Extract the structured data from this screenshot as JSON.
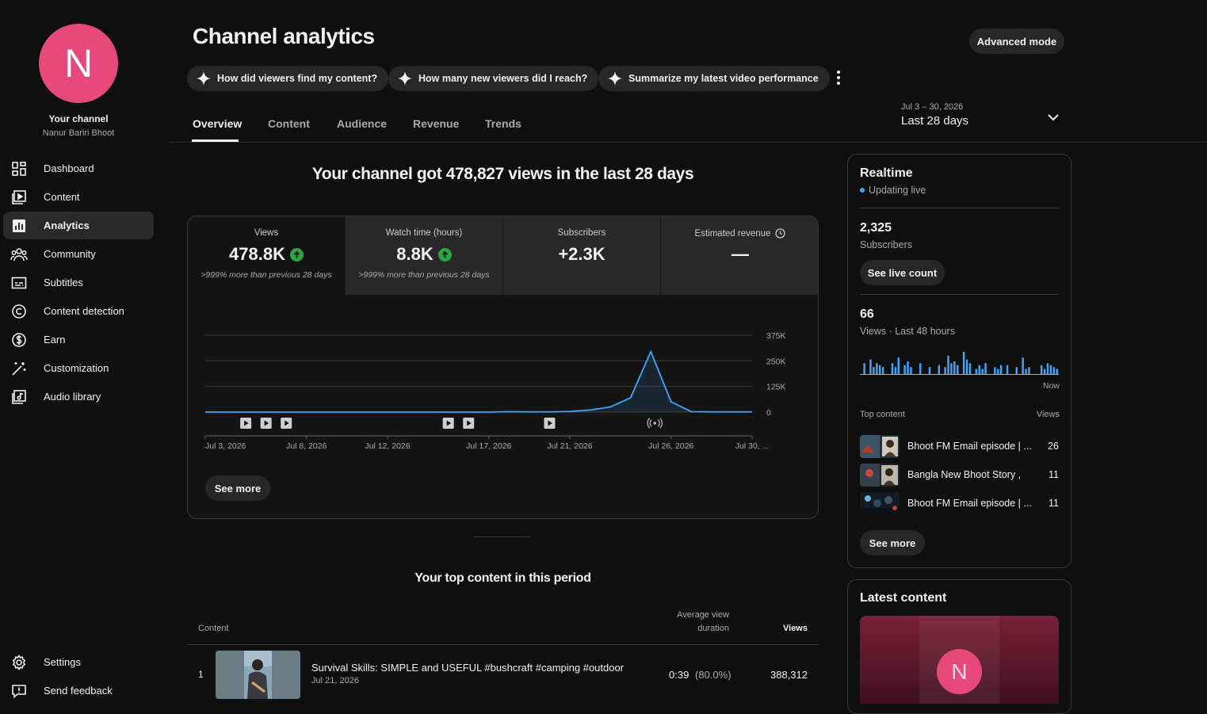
{
  "channel": {
    "avatar_letter": "N",
    "label": "Your channel",
    "name": "Nanur Bariri Bhoot"
  },
  "nav": [
    {
      "label": "Dashboard",
      "icon": "dashboard-icon"
    },
    {
      "label": "Content",
      "icon": "content-icon"
    },
    {
      "label": "Analytics",
      "icon": "analytics-icon"
    },
    {
      "label": "Community",
      "icon": "community-icon"
    },
    {
      "label": "Subtitles",
      "icon": "subtitles-icon"
    },
    {
      "label": "Content detection",
      "icon": "copyright-icon"
    },
    {
      "label": "Earn",
      "icon": "dollar-icon"
    },
    {
      "label": "Customization",
      "icon": "magic-wand-icon"
    },
    {
      "label": "Audio library",
      "icon": "audio-library-icon"
    }
  ],
  "nav_bottom": [
    {
      "label": "Settings",
      "icon": "gear-icon"
    },
    {
      "label": "Send feedback",
      "icon": "feedback-icon"
    }
  ],
  "header": {
    "title": "Channel analytics",
    "advanced_mode": "Advanced mode",
    "chips": [
      "How did viewers find my content?",
      "How many new viewers did I reach?",
      "Summarize my latest video performance"
    ],
    "tabs": [
      "Overview",
      "Content",
      "Audience",
      "Revenue",
      "Trends"
    ],
    "date_range_sub": "Jul 3 – 30, 2026",
    "date_range_main": "Last 28 days"
  },
  "overview": {
    "headline": "Your channel got 478,827 views in the last 28 days",
    "metrics": [
      {
        "label": "Views",
        "value": "478.8K",
        "sub": ">999% more than previous 28 days",
        "trend": "up"
      },
      {
        "label": "Watch time (hours)",
        "value": "8.8K",
        "sub": ">999% more than previous 28 days",
        "trend": "up"
      },
      {
        "label": "Subscribers",
        "value": "+2.3K",
        "sub": "",
        "trend": ""
      },
      {
        "label": "Estimated revenue",
        "value": "—",
        "sub": "",
        "trend": ""
      }
    ],
    "see_more": "See more"
  },
  "chart_data": {
    "type": "area",
    "x": [
      "Jul 3",
      "Jul 4",
      "Jul 5",
      "Jul 6",
      "Jul 7",
      "Jul 8",
      "Jul 9",
      "Jul 10",
      "Jul 11",
      "Jul 12",
      "Jul 13",
      "Jul 14",
      "Jul 15",
      "Jul 16",
      "Jul 17",
      "Jul 18",
      "Jul 19",
      "Jul 20",
      "Jul 21",
      "Jul 22",
      "Jul 23",
      "Jul 24",
      "Jul 25",
      "Jul 26",
      "Jul 27",
      "Jul 28",
      "Jul 29",
      "Jul 30"
    ],
    "values": [
      0,
      0,
      0,
      0,
      0,
      0,
      0,
      0,
      0,
      0,
      0,
      0,
      0,
      0,
      0,
      2000,
      1000,
      1000,
      3000,
      10000,
      25000,
      70000,
      295000,
      50000,
      2000,
      1000,
      1000,
      1000
    ],
    "x_tick_labels": [
      "Jul 3, 2026",
      "Jul 8, 2026",
      "Jul 12, 2026",
      "Jul 17, 2026",
      "Jul 21, 2026",
      "Jul 26, 2026",
      "Jul 30, ..."
    ],
    "x_tick_indices": [
      0,
      5,
      9,
      14,
      18,
      23,
      27
    ],
    "y_ticks": [
      0,
      125000,
      250000,
      375000
    ],
    "y_tick_labels": [
      "0",
      "125K",
      "250K",
      "375K"
    ],
    "ylim": [
      0,
      375000
    ],
    "video_markers": [
      2,
      3,
      4,
      12,
      13,
      17
    ],
    "live_markers": [
      22
    ],
    "grid": true,
    "color": "#3ea6ff"
  },
  "top_content": {
    "title": "Your top content in this period",
    "col_content": "Content",
    "col_avd_line1": "Average view",
    "col_avd_line2": "duration",
    "col_views": "Views",
    "rows": [
      {
        "rank": "1",
        "title": "Survival Skills: SIMPLE and USEFUL #bushcraft #camping #outdoor",
        "date": "Jul 21, 2026",
        "avd": "0:39",
        "avd_pct": "(80.0%)",
        "views": "388,312"
      }
    ]
  },
  "realtime": {
    "title": "Realtime",
    "status": "Updating live",
    "subs_value": "2,325",
    "subs_label": "Subscribers",
    "see_live_count": "See live count",
    "views_value": "66",
    "views_label": "Views · Last 48 hours",
    "now_label": "Now",
    "bars": [
      0,
      4,
      0,
      6,
      2,
      4,
      3,
      2,
      0,
      0,
      4,
      2,
      7,
      0,
      3,
      5,
      2,
      0,
      0,
      4,
      0,
      0,
      2,
      0,
      0,
      3,
      0,
      2,
      8,
      4,
      5,
      3,
      0,
      10,
      6,
      4,
      0,
      1,
      3,
      1,
      4,
      0,
      0,
      2,
      1,
      3,
      0,
      3,
      0,
      0,
      2,
      0,
      7,
      1,
      2,
      0,
      0,
      0,
      3,
      1,
      4,
      3,
      2,
      1
    ],
    "top_content_label": "Top content",
    "views_col": "Views",
    "items": [
      {
        "title": "Bhoot FM Email episode | ...",
        "views": "26"
      },
      {
        "title": "Bangla New Bhoot Story ,",
        "views": "11"
      },
      {
        "title": "Bhoot FM Email episode | ...",
        "views": "11"
      }
    ],
    "see_more": "See more"
  },
  "latest": {
    "title": "Latest content",
    "avatar_letter": "N"
  },
  "colors": {
    "accent_pink": "#e8497d",
    "up_green": "#2ba640",
    "chart_blue": "#3ea6ff"
  }
}
